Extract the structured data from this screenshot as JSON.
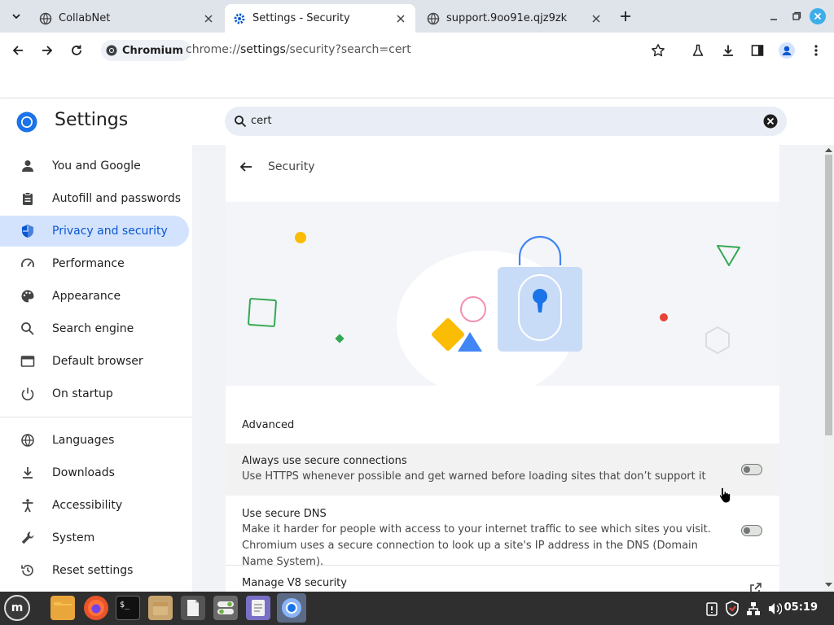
{
  "tabs": [
    {
      "label": "CollabNet",
      "icon": "globe-icon",
      "active": false
    },
    {
      "label": "Settings - Security",
      "icon": "settings-gear-icon",
      "active": true
    },
    {
      "label": "support.9oo91e.qjz9zk",
      "icon": "globe-icon",
      "active": false
    }
  ],
  "toolbar": {
    "chip_label": "Chromium",
    "url_prefix": "chrome://",
    "url_host": "settings",
    "url_rest": "/security?search=cert"
  },
  "settings": {
    "title": "Settings",
    "search_value": "cert"
  },
  "sidebar": {
    "items": [
      {
        "label": "You and Google",
        "icon": "person-icon"
      },
      {
        "label": "Autofill and passwords",
        "icon": "clipboard-icon"
      },
      {
        "label": "Privacy and security",
        "icon": "shield-icon",
        "active": true
      },
      {
        "label": "Performance",
        "icon": "speedometer-icon"
      },
      {
        "label": "Appearance",
        "icon": "palette-icon"
      },
      {
        "label": "Search engine",
        "icon": "search-icon"
      },
      {
        "label": "Default browser",
        "icon": "browser-window-icon"
      },
      {
        "label": "On startup",
        "icon": "power-icon"
      },
      {
        "label": "Languages",
        "icon": "globe-icon"
      },
      {
        "label": "Downloads",
        "icon": "download-icon"
      },
      {
        "label": "Accessibility",
        "icon": "accessibility-icon"
      },
      {
        "label": "System",
        "icon": "wrench-icon"
      },
      {
        "label": "Reset settings",
        "icon": "history-icon"
      }
    ]
  },
  "main": {
    "page_title": "Security",
    "section_heading": "Advanced",
    "rows": [
      {
        "title": "Always use secure connections",
        "desc": "Use HTTPS whenever possible and get warned before loading sites that don’t support it",
        "toggle_on": false
      },
      {
        "title": "Use secure DNS",
        "desc": "Make it harder for people with access to your internet traffic to see which sites you visit. Chromium uses a secure connection to look up a site's IP address in the DNS (Domain Name System).",
        "toggle_on": false
      },
      {
        "title": "Manage V8 security"
      }
    ]
  },
  "taskbar": {
    "clock": "05:19"
  },
  "colors": {
    "accent": "#0b57d0",
    "active_nav_bg": "#d3e3fd",
    "tabstrip_bg": "#dfe3ea",
    "taskbar_bg": "#2f2f2f"
  }
}
